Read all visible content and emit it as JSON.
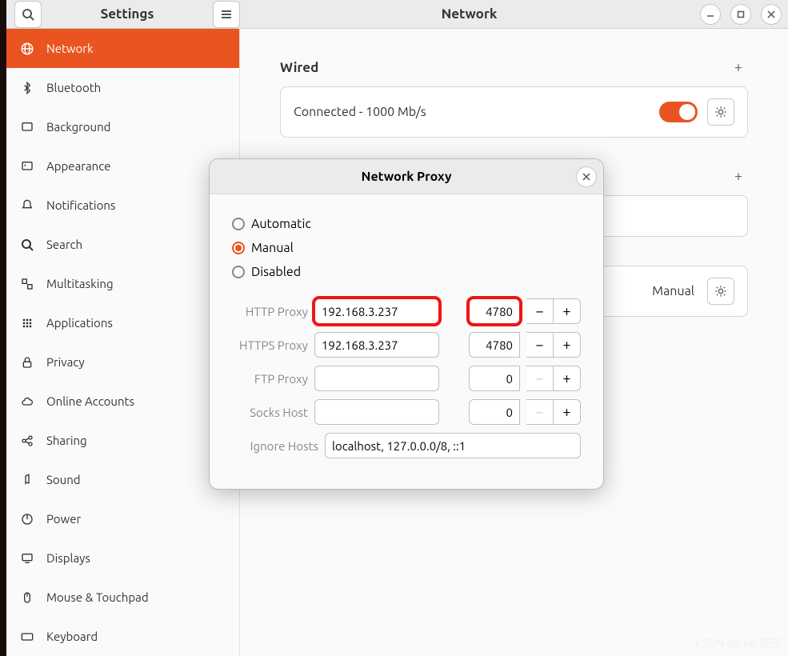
{
  "titlebar": {
    "settings_title": "Settings",
    "page_title": "Network"
  },
  "sidebar": {
    "items": [
      {
        "label": "Network",
        "icon": "globe-icon",
        "active": true
      },
      {
        "label": "Bluetooth",
        "icon": "bluetooth-icon"
      },
      {
        "label": "Background",
        "icon": "background-icon"
      },
      {
        "label": "Appearance",
        "icon": "appearance-icon"
      },
      {
        "label": "Notifications",
        "icon": "bell-icon"
      },
      {
        "label": "Search",
        "icon": "search-icon"
      },
      {
        "label": "Multitasking",
        "icon": "multitasking-icon"
      },
      {
        "label": "Applications",
        "icon": "apps-icon"
      },
      {
        "label": "Privacy",
        "icon": "lock-icon"
      },
      {
        "label": "Online Accounts",
        "icon": "cloud-icon"
      },
      {
        "label": "Sharing",
        "icon": "sharing-icon"
      },
      {
        "label": "Sound",
        "icon": "sound-icon"
      },
      {
        "label": "Power",
        "icon": "power-icon"
      },
      {
        "label": "Displays",
        "icon": "displays-icon"
      },
      {
        "label": "Mouse & Touchpad",
        "icon": "mouse-icon"
      },
      {
        "label": "Keyboard",
        "icon": "keyboard-icon"
      }
    ]
  },
  "content": {
    "wired": {
      "title": "Wired",
      "status": "Connected - 1000 Mb/s",
      "toggle_on": true
    },
    "proxy_summary": {
      "mode_label": "Manual"
    }
  },
  "modal": {
    "title": "Network Proxy",
    "mode": "manual",
    "options": {
      "automatic": "Automatic",
      "manual": "Manual",
      "disabled": "Disabled"
    },
    "rows": {
      "http": {
        "label": "HTTP Proxy",
        "host": "192.168.3.237",
        "port": "4780",
        "highlight": true
      },
      "https": {
        "label": "HTTPS Proxy",
        "host": "192.168.3.237",
        "port": "4780"
      },
      "ftp": {
        "label": "FTP Proxy",
        "host": "",
        "port": "0"
      },
      "socks": {
        "label": "Socks Host",
        "host": "",
        "port": "0"
      },
      "ignore": {
        "label": "Ignore Hosts",
        "value": "localhost, 127.0.0.0/8, ::1"
      }
    }
  },
  "watermark": "CSDN @Leo-夜空"
}
